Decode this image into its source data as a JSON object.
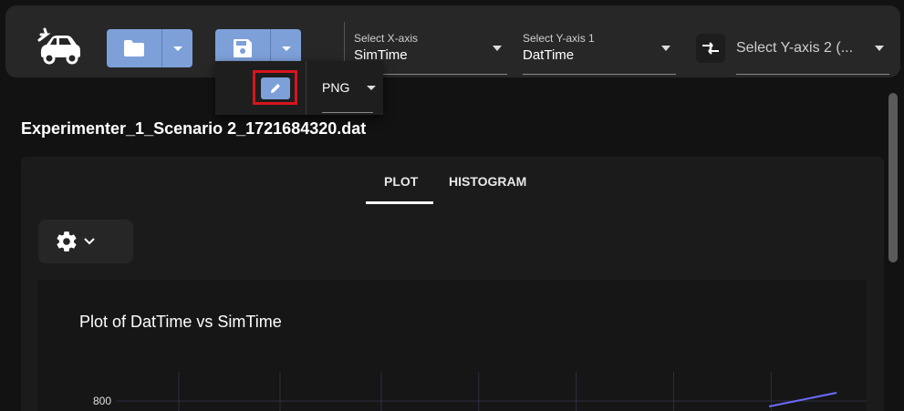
{
  "toolbar": {
    "x_axis": {
      "label": "Select X-axis",
      "value": "SimTime"
    },
    "y_axis_1": {
      "label": "Select Y-axis 1",
      "value": "DatTime"
    },
    "y_axis_2": {
      "placeholder": "Select Y-axis 2 (..."
    }
  },
  "export_menu": {
    "format": "PNG"
  },
  "file": {
    "name": "Experimenter_1_Scenario 2_1721684320.dat"
  },
  "tabs": [
    {
      "label": "PLOT",
      "active": true
    },
    {
      "label": "HISTOGRAM",
      "active": false
    }
  ],
  "colors": {
    "accent": "#7da0d9",
    "highlight": "#d8141e",
    "series": "#6b6bff"
  },
  "chart_data": {
    "type": "line",
    "title": "Plot of DatTime vs SimTime",
    "y_tick_labels": [
      "800"
    ],
    "series": [
      {
        "x": [
          0.87,
          0.96
        ],
        "y": [
          780,
          830
        ]
      }
    ],
    "grid": true
  }
}
